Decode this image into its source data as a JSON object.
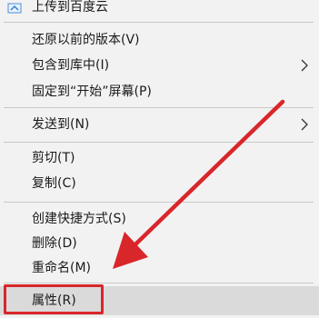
{
  "menu": {
    "items": [
      {
        "label": "上传到百度云"
      },
      {
        "label": "还原以前的版本(V)"
      },
      {
        "label": "包含到库中(I)"
      },
      {
        "label": "固定到“开始”屏幕(P)"
      },
      {
        "label": "发送到(N)"
      },
      {
        "label": "剪切(T)"
      },
      {
        "label": "复制(C)"
      },
      {
        "label": "创建快捷方式(S)"
      },
      {
        "label": "删除(D)"
      },
      {
        "label": "重命名(M)"
      },
      {
        "label": "属性(R)"
      }
    ]
  },
  "icons": {
    "top_item_icon": "cloud-upload-icon",
    "submenu_chevron": "chevron-right-icon",
    "annotation": "red-arrow-annotation"
  },
  "colors": {
    "menu_background": "#f2f2f2",
    "separator": "#c9c9c9",
    "selected_background": "#dadada",
    "annotation_red": "#d9262b",
    "text": "#1a1a1a"
  },
  "selected_item": "属性(R)"
}
